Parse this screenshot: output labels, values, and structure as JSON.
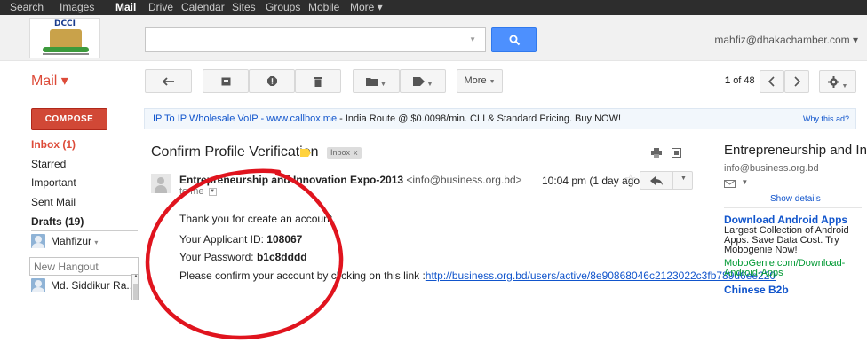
{
  "topnav": {
    "items": [
      {
        "label": "Search",
        "active": false
      },
      {
        "label": "Images",
        "active": false
      },
      {
        "label": "Mail",
        "active": true
      },
      {
        "label": "Drive",
        "active": false
      },
      {
        "label": "Calendar",
        "active": false
      },
      {
        "label": "Sites",
        "active": false
      },
      {
        "label": "Groups",
        "active": false
      },
      {
        "label": "Mobile",
        "active": false
      },
      {
        "label": "More ▾",
        "active": false
      }
    ]
  },
  "header": {
    "logo_text": "DCCI",
    "search_value": "",
    "account": "mahfiz@dhakachamber.com ▾"
  },
  "toolbar": {
    "mail_label": "Mail ▾",
    "more_label": "More",
    "pager_current": "1",
    "pager_total": "of 48"
  },
  "sidebar": {
    "compose_label": "COMPOSE",
    "items": [
      {
        "label": "Inbox (1)"
      },
      {
        "label": "Starred"
      },
      {
        "label": "Important"
      },
      {
        "label": "Sent Mail"
      },
      {
        "label": "Drafts (19)"
      }
    ],
    "me_name": "Mahfizur",
    "hangout_placeholder": "New Hangout",
    "contact_name": "Md. Siddikur Ra..."
  },
  "adbar": {
    "link_text": "IP To IP Wholesale VoIP - www.callbox.me",
    "rest_text": " - India Route @ $0.0098/min. CLI & Standard Pricing. Buy NOW!",
    "why_label": "Why this ad?"
  },
  "message": {
    "subject": "Confirm Profile Verification",
    "label_chip": "Inbox",
    "label_chip_close": "x",
    "sender_name": "Entrepreneurship and Innovation Expo-2013",
    "sender_email": " <info@business.org.bd>",
    "to": "to me",
    "time": "10:04 pm (1 day ago)",
    "line1": "Thank you for create an account.",
    "applicant_label": "Your Applicant ID: ",
    "applicant_id": "108067",
    "password_label": "Your Password: ",
    "password": "b1c8dddd",
    "confirm_text": "Please confirm your account by clicking on this link :",
    "confirm_link": "http://business.org.bd/users/active/8e90868046c2123022c3fb789d6ee220"
  },
  "right_panel": {
    "name": "Entrepreneurship and Inno...",
    "email": "info@business.org.bd",
    "show_details": "Show details",
    "ad1_title": "Download Android Apps",
    "ad1_text": "Largest Collection of Android Apps. Save Data Cost. Try Mobogenie Now!",
    "ad1_url": "MoboGenie.com/Download-Android-Apps",
    "ad2_title": "Chinese B2b"
  },
  "colors": {
    "accent_red": "#dd4b39",
    "compose_red": "#d14836",
    "link_blue": "#1155cc",
    "search_blue": "#4d90fe",
    "ad_green": "#009933",
    "annotation_circle": "#e0141e"
  }
}
